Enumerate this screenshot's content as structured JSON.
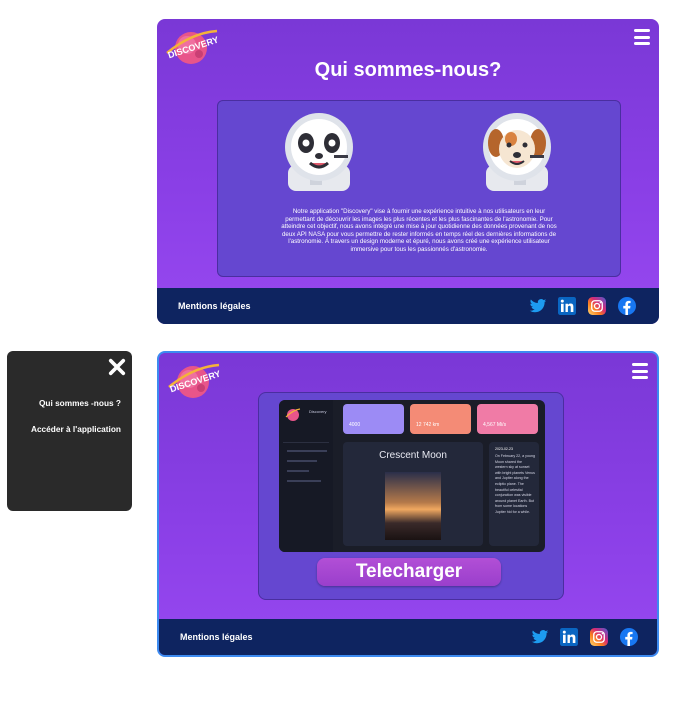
{
  "brand": {
    "logo_text": "DISCOVERY"
  },
  "about": {
    "title": "Qui sommes-nous?",
    "text": "Notre application \"Discovery\" vise à fournir une expérience intuitive à nos utilisateurs en leur permettant de découvrir les images les plus récentes et les plus fascinantes de l'astronomie. Pour atteindre cet objectif, nous avons intégré une mise à jour quotidienne des données provenant de nos deux API NASA pour vous permettre de rester informés en temps réel des dernières informations de l'astronomie. À travers un design moderne et épuré, nous avons créé une expérience utilisateur immersive pour tous les passionnés d'astronomie."
  },
  "footer": {
    "legal_label": "Mentions légales",
    "social": [
      "twitter-icon",
      "linkedin-icon",
      "instagram-icon",
      "facebook-icon"
    ]
  },
  "menu": {
    "items": [
      "Qui sommes -nous ?",
      "Accéder à l'application"
    ]
  },
  "download": {
    "button_label": "Telecharger",
    "preview": {
      "app_name": "Discovery",
      "stats": [
        {
          "value": "4000",
          "color": "#9c8bf5"
        },
        {
          "value": "12 742 km",
          "color": "#f48b76"
        },
        {
          "value": "4,567 Mi/s",
          "color": "#f07ba6"
        }
      ],
      "image_title": "Crescent Moon",
      "date": "2023-02-23",
      "description": "On February 22, a young Moon shared the western sky at sunset with bright planets Venus and Jupiter along the ecliptic plane. The beautiful celestial conjunction was visible around planet Earth. But from some locations Jupiter hid for a while."
    }
  },
  "colors": {
    "panel": "#8a3fe6",
    "inner": "#6547d0",
    "footer": "#0e2460",
    "menu": "#2a2a2a",
    "button": "#a848d2"
  }
}
